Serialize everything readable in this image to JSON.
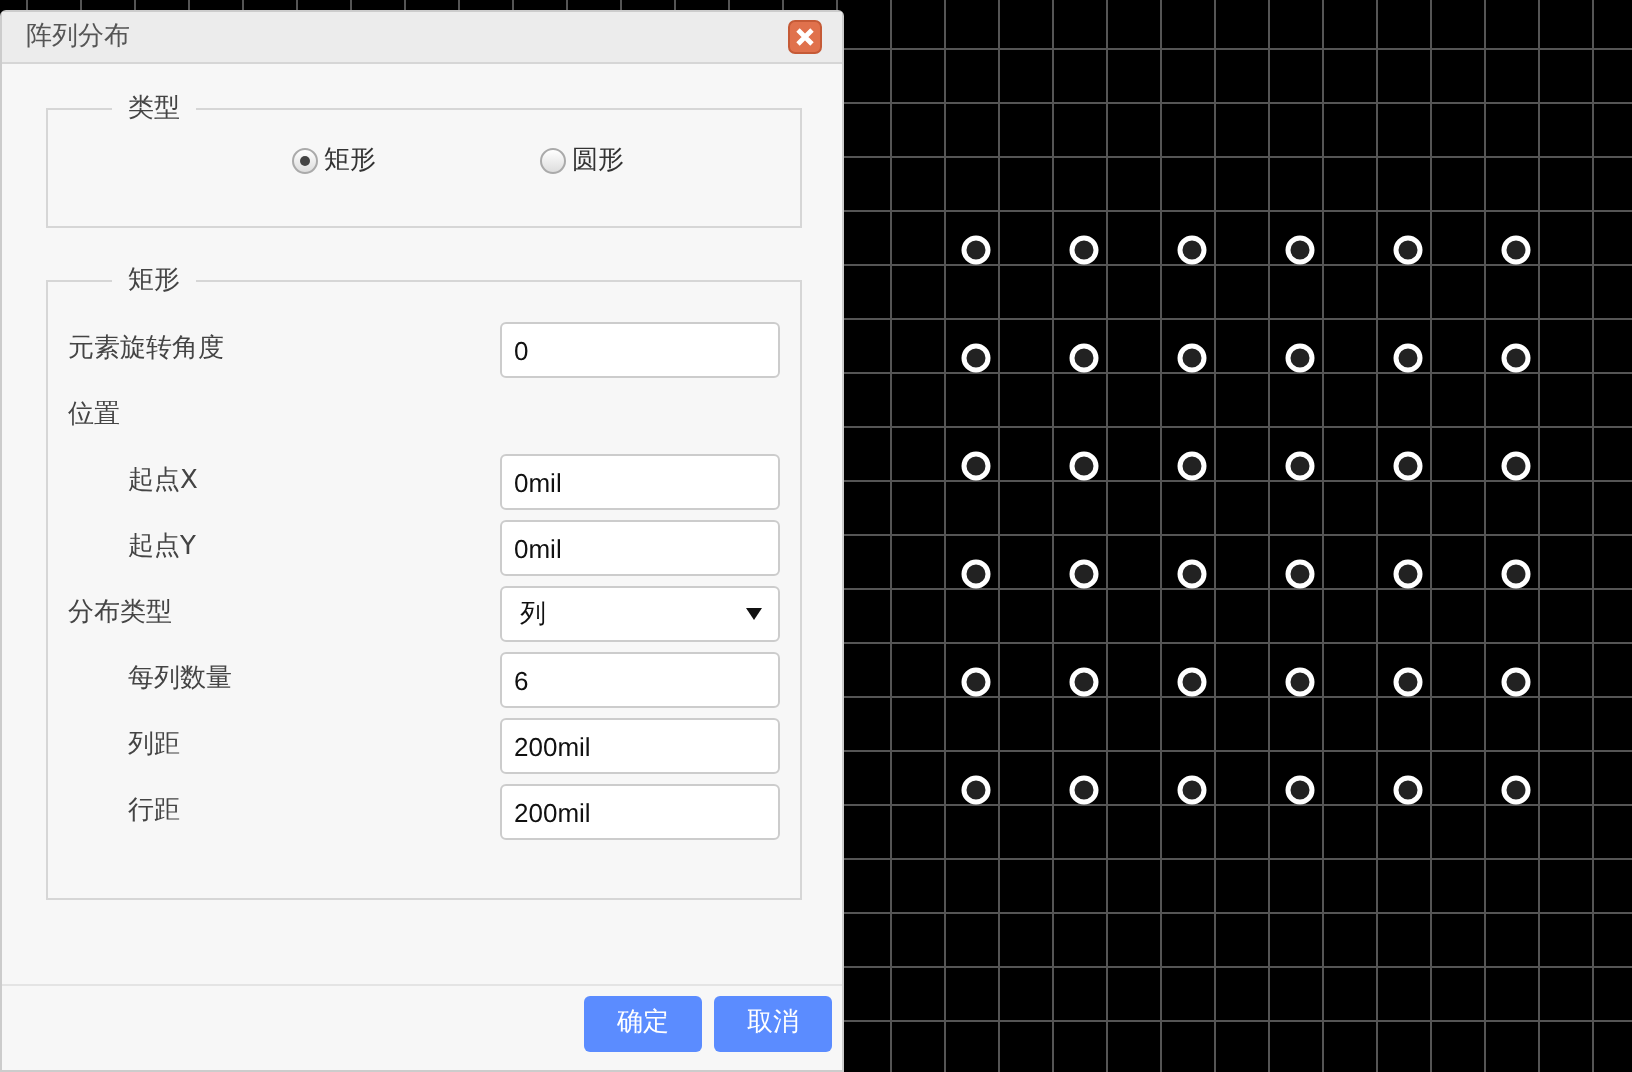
{
  "dialog": {
    "title": "阵列分布",
    "type_group": {
      "legend": "类型",
      "options": [
        {
          "label": "矩形",
          "selected": true
        },
        {
          "label": "圆形",
          "selected": false
        }
      ]
    },
    "rect_group": {
      "legend": "矩形",
      "fields": [
        {
          "kind": "input",
          "label": "元素旋转角度",
          "value": "0",
          "indented": false
        },
        {
          "kind": "heading",
          "label": "位置",
          "indented": false
        },
        {
          "kind": "input",
          "label": "起点X",
          "value": "0mil",
          "indented": true
        },
        {
          "kind": "input",
          "label": "起点Y",
          "value": "0mil",
          "indented": true
        },
        {
          "kind": "select",
          "label": "分布类型",
          "value": "列",
          "indented": false
        },
        {
          "kind": "input",
          "label": "每列数量",
          "value": "6",
          "indented": true
        },
        {
          "kind": "input",
          "label": "列距",
          "value": "200mil",
          "indented": true
        },
        {
          "kind": "input",
          "label": "行距",
          "value": "200mil",
          "indented": true
        }
      ]
    },
    "buttons": [
      "确定",
      "取消"
    ]
  }
}
